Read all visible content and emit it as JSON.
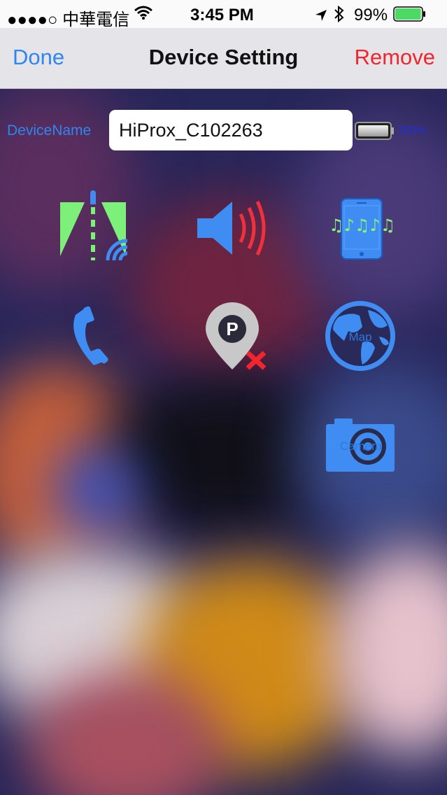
{
  "status_bar": {
    "carrier": "●●●●○ 中華電信",
    "time": "3:45 PM",
    "battery_percent": "99%",
    "battery_level": 0.99
  },
  "nav": {
    "done_label": "Done",
    "title": "Device Setting",
    "remove_label": "Remove"
  },
  "device": {
    "name_label": "DeviceName",
    "name_value": "HiProx_C102263",
    "battery_percent": "100%",
    "battery_level": 1.0
  },
  "icons": {
    "map_caption": "Map",
    "camera_caption": "Camera"
  },
  "colors": {
    "accent_blue": "#2f86ee",
    "icon_blue": "#3f8cf2",
    "destructive_red": "#f0252d",
    "lane_green": "#7df07a"
  }
}
